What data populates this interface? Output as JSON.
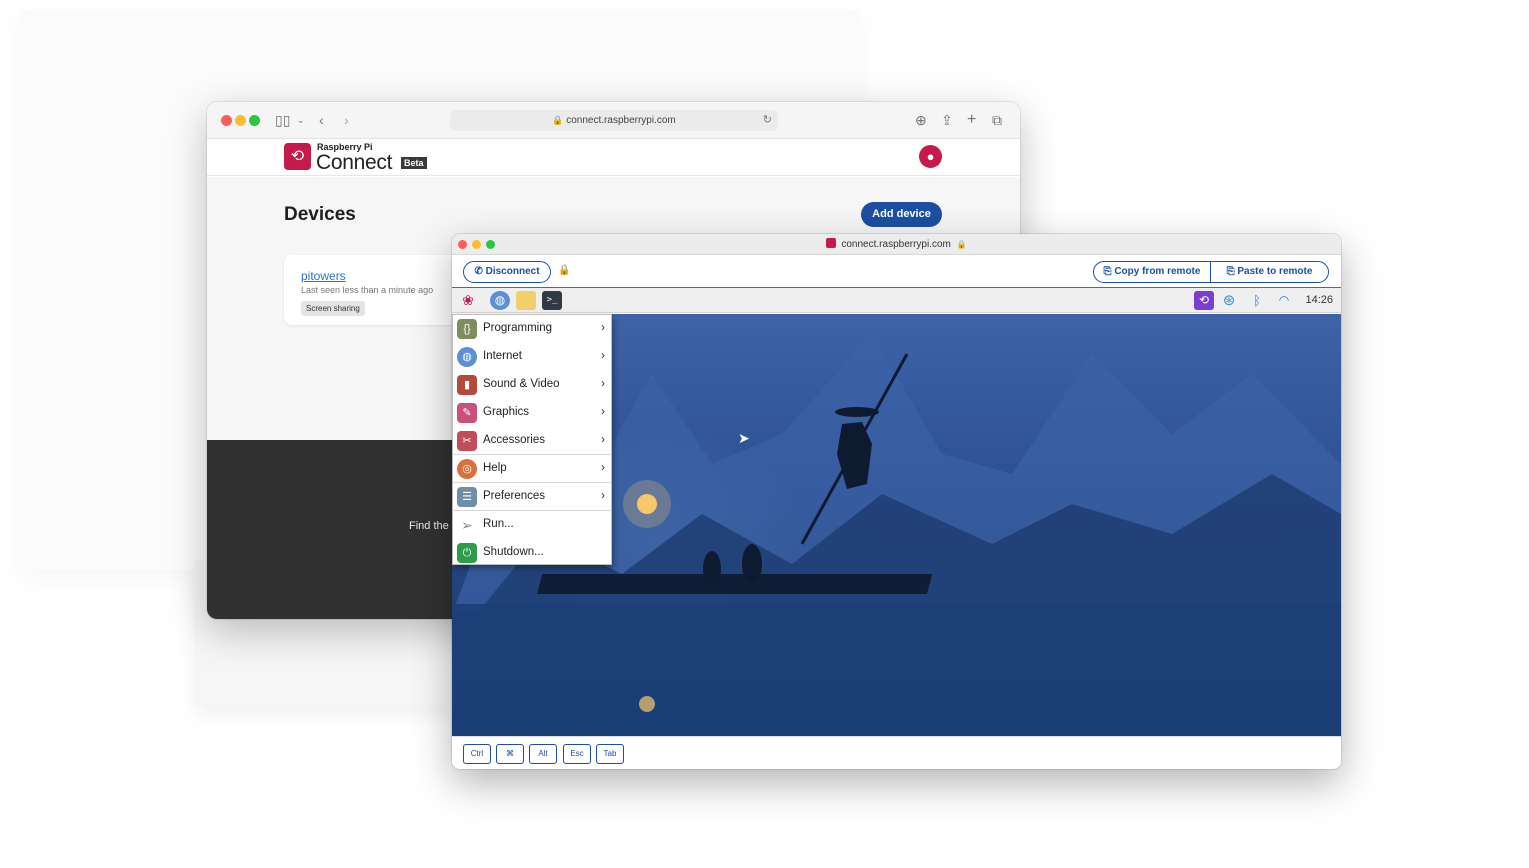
{
  "back_browser": {
    "url": "connect.raspberrypi.com",
    "logo_top": "Raspberry Pi",
    "logo_main": "Connect",
    "logo_badge": "Beta",
    "page_title": "Devices",
    "add_device_label": "Add device",
    "device": {
      "name": "pitowers",
      "last_seen": "Last seen less than a minute ago",
      "tag": "Screen sharing"
    },
    "footer_text": "Find the"
  },
  "remote_window": {
    "title_url": "connect.raspberrypi.com",
    "disconnect_label": "Disconnect",
    "copy_label": "Copy from remote",
    "paste_label": "Paste to remote",
    "clock": "14:26",
    "menu_items": [
      {
        "label": "Programming",
        "icon": "programming-icon",
        "submenu": true
      },
      {
        "label": "Internet",
        "icon": "internet-icon",
        "submenu": true
      },
      {
        "label": "Sound & Video",
        "icon": "sound-video-icon",
        "submenu": true
      },
      {
        "label": "Graphics",
        "icon": "graphics-icon",
        "submenu": true
      },
      {
        "label": "Accessories",
        "icon": "accessories-icon",
        "submenu": true
      },
      {
        "label": "Help",
        "icon": "help-icon",
        "submenu": true
      },
      {
        "label": "Preferences",
        "icon": "preferences-icon",
        "submenu": true
      },
      {
        "label": "Run...",
        "icon": "run-icon",
        "submenu": false
      },
      {
        "label": "Shutdown...",
        "icon": "shutdown-icon",
        "submenu": false
      }
    ],
    "keys": [
      "Ctrl",
      "⌘",
      "Alt",
      "Esc",
      "Tab"
    ]
  },
  "colors": {
    "accent": "#1c4fa1",
    "brand": "#c51a4a"
  }
}
